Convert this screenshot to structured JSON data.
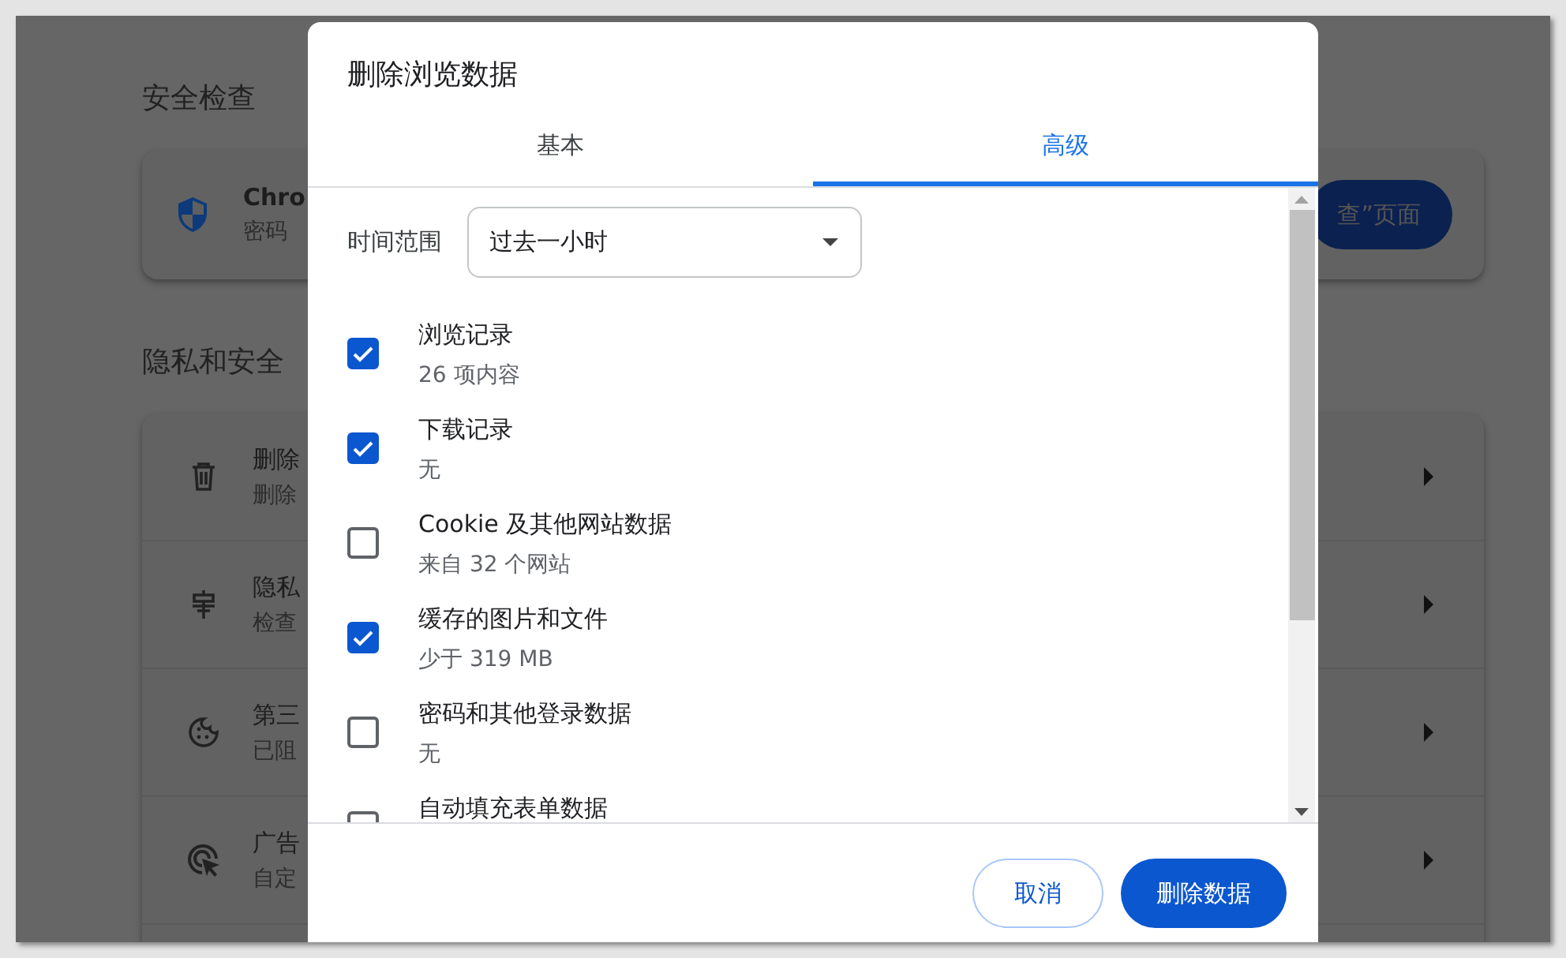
{
  "page": {
    "safety_section": {
      "title": "安全检查",
      "card": {
        "title": "Chro",
        "subtitle": "密码",
        "button": "查”页面"
      }
    },
    "privacy_section": {
      "title": "隐私和安全",
      "rows": [
        {
          "title": "删除",
          "subtitle": "删除"
        },
        {
          "title": "隐私",
          "subtitle": "检查"
        },
        {
          "title": "第三",
          "subtitle": "已阻"
        },
        {
          "title": "广告",
          "subtitle": "自定"
        }
      ]
    }
  },
  "dialog": {
    "title": "删除浏览数据",
    "tabs": [
      {
        "label": "基本",
        "selected": false
      },
      {
        "label": "高级",
        "selected": true
      }
    ],
    "time_range": {
      "label": "时间范围",
      "value": "过去一小时"
    },
    "options": [
      {
        "title": "浏览记录",
        "detail": "26 项内容",
        "checked": true
      },
      {
        "title": "下载记录",
        "detail": "无",
        "checked": true
      },
      {
        "title": "Cookie 及其他网站数据",
        "detail": "来自 32 个网站",
        "checked": false
      },
      {
        "title": "缓存的图片和文件",
        "detail": "少于 319 MB",
        "checked": true
      },
      {
        "title": "密码和其他登录数据",
        "detail": "无",
        "checked": false
      },
      {
        "title": "自动填充表单数据",
        "checked": false
      }
    ],
    "buttons": {
      "cancel": "取消",
      "confirm": "删除数据"
    }
  }
}
